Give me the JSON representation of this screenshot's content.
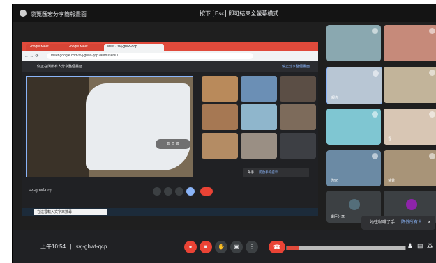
{
  "window": {
    "title": "瀏覽匯宏分享簡報畫面"
  },
  "esc_hint": {
    "prefix": "按下",
    "key": "Esc",
    "suffix": "即可結束全螢幕模式"
  },
  "shared_screen": {
    "tabs": [
      "Google Meet",
      "Google Meet",
      "Meet - svj-ghwf-qcp"
    ],
    "url": "meet.google.com/svj-ghwf-qcp?authuser=0",
    "banner_text": "你正在與所有人分享整個畫面",
    "banner_stop": "停止分享整個畫面",
    "meeting_code": "svj-ghwf-qcp",
    "notif_text": "舉手",
    "notif_action": "開啟手的提示",
    "taskbar_search": "在這裡輸入文字來搜尋",
    "tile_label": "剛開始"
  },
  "participants": [
    {
      "label": ""
    },
    {
      "label": ""
    },
    {
      "label": "親你"
    },
    {
      "label": ""
    },
    {
      "label": ""
    },
    {
      "label": "昏"
    },
    {
      "label": "你家"
    },
    {
      "label": "爸爸"
    },
    {
      "label": "遺臣分享"
    },
    {
      "label": ""
    }
  ],
  "hand_notif": {
    "message": "她往咖啡了手",
    "action": "降低所有人",
    "close": "✕"
  },
  "bottom": {
    "time": "上午10:54",
    "separator": "|",
    "meeting_code": "svj-ghwf-qcp",
    "progress_fraction": 0.1
  },
  "colors": {
    "accent_red": "#ea4335",
    "link_blue": "#8ab4f8",
    "bar_bg": "#202124"
  }
}
